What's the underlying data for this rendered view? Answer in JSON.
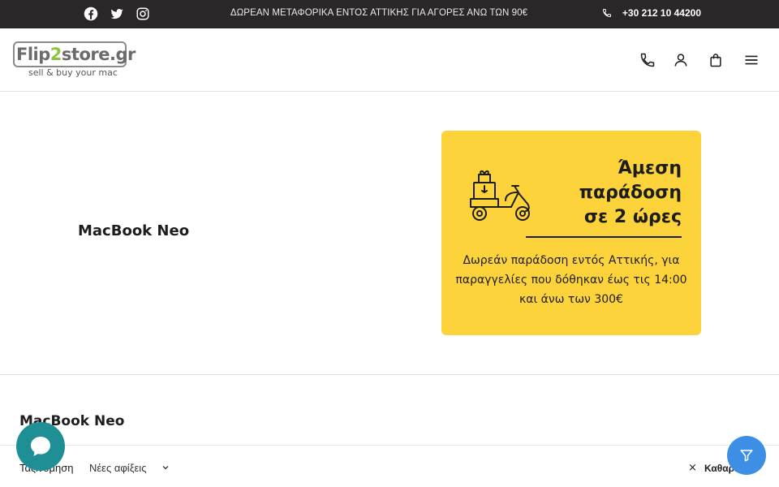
{
  "topbar": {
    "social_icons": [
      "facebook-icon",
      "twitter-icon",
      "instagram-icon"
    ],
    "promo_text": "ΔΩΡΕΑΝ ΜΕΤΑΦΟΡΙΚΑ ΕΝΤΟΣ ΑΤΤΙΚΗΣ ΓΙΑ ΑΓΟΡΕΣ ΑΝΩ ΤΩΝ 90€",
    "phone": "+30 212 10 44200"
  },
  "header": {
    "logo_main": "Flip",
    "logo_accent": "2",
    "logo_rest": "store.gr",
    "logo_tagline": "sell & buy your mac",
    "icons": [
      "phone-icon",
      "user-icon",
      "cart-icon",
      "menu-icon"
    ]
  },
  "hero": {
    "title": "MacBook Neo",
    "promo_card": {
      "headline_1": "Άμεση",
      "headline_2": "παράδοση",
      "headline_3": "σε 2 ώρες",
      "description": "Δωρεάν παράδοση εντός Αττικής, για παραγγελίες που δόθηκαν έως τις 14:00 και άνω των 300€"
    }
  },
  "listing": {
    "title": "MacBook Neo",
    "sort_label": "Ταξινόμηση",
    "sort_value": "Νέες αφίξεις",
    "clear_label": "Καθαρισ"
  },
  "colors": {
    "topbar_bg": "#2b2627",
    "promo_card_bg": "#fcd33a",
    "chat_button": "#1e8f95",
    "filter_button": "#3d8fe6",
    "logo_accent": "#8bc53f"
  }
}
